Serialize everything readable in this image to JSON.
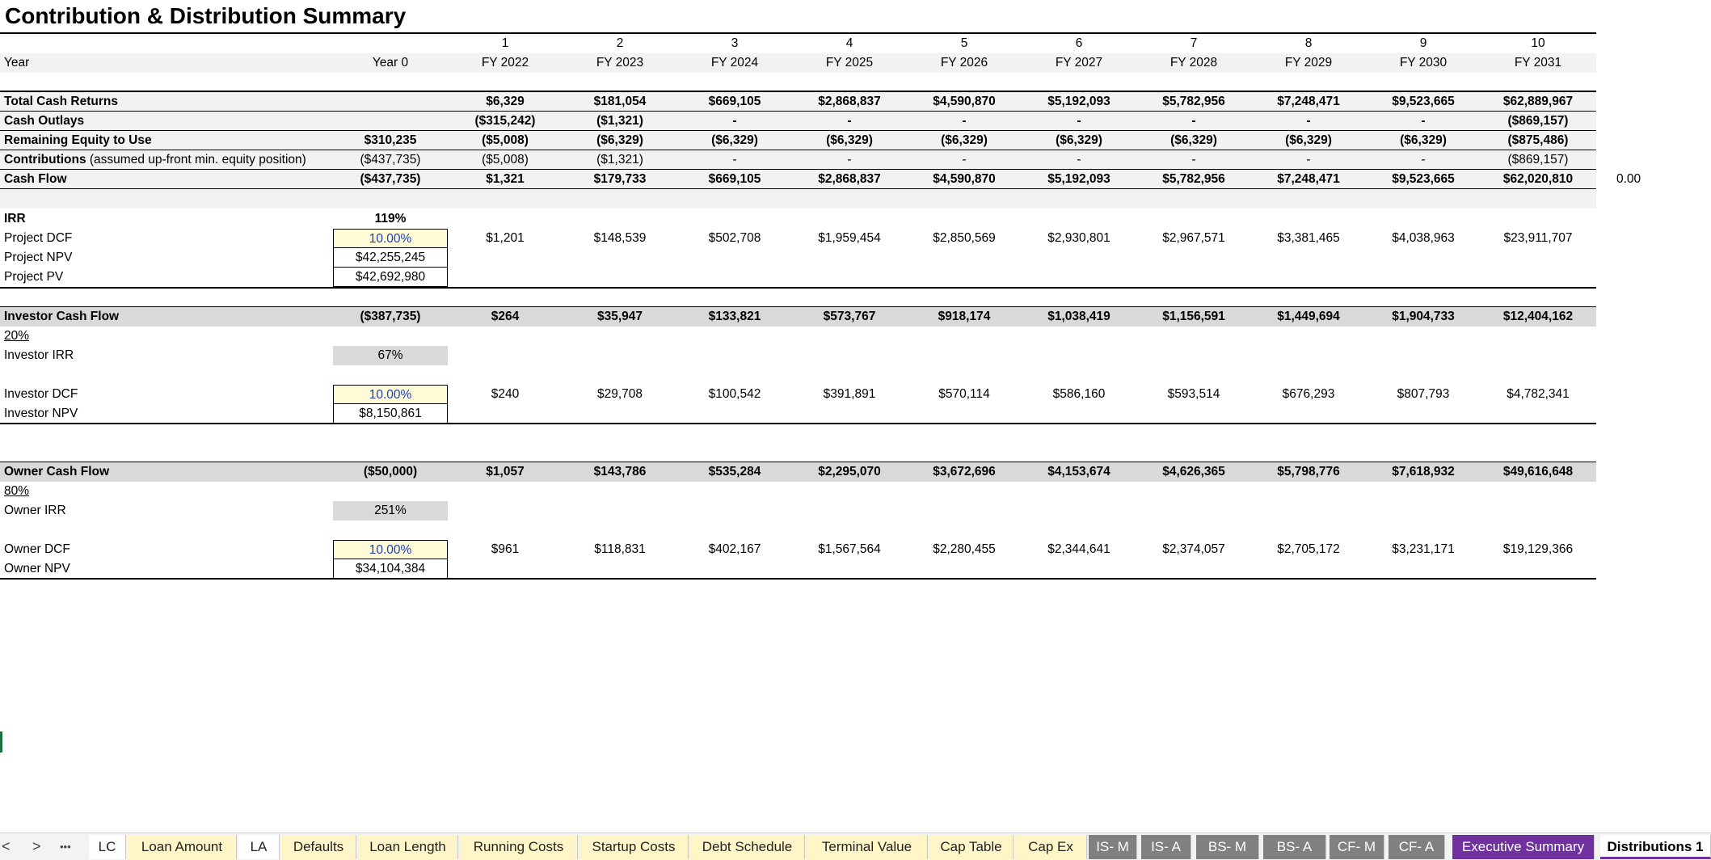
{
  "title": "Contribution & Distribution Summary",
  "period_numbers": [
    "1",
    "2",
    "3",
    "4",
    "5",
    "6",
    "7",
    "8",
    "9",
    "10"
  ],
  "header": {
    "label": "Year",
    "year0": "Year 0",
    "years": [
      "FY 2022",
      "FY 2023",
      "FY 2024",
      "FY 2025",
      "FY 2026",
      "FY 2027",
      "FY 2028",
      "FY 2029",
      "FY 2030",
      "FY 2031"
    ]
  },
  "summary_rows": [
    {
      "label": "Total Cash Returns",
      "y0": "",
      "values": [
        "$6,329",
        "$181,054",
        "$669,105",
        "$2,868,837",
        "$4,590,870",
        "$5,192,093",
        "$5,782,956",
        "$7,248,471",
        "$9,523,665",
        "$62,889,967"
      ]
    },
    {
      "label": "Cash Outlays",
      "y0": "",
      "values": [
        "($315,242)",
        "($1,321)",
        "-",
        "-",
        "-",
        "-",
        "-",
        "-",
        "-",
        "($869,157)"
      ]
    },
    {
      "label": "Remaining Equity to Use",
      "y0": "$310,235",
      "values": [
        "($5,008)",
        "($6,329)",
        "($6,329)",
        "($6,329)",
        "($6,329)",
        "($6,329)",
        "($6,329)",
        "($6,329)",
        "($6,329)",
        "($875,486)"
      ]
    },
    {
      "label": "Contributions",
      "label_suffix": " (assumed up-front min. equity position)",
      "y0": "($437,735)",
      "values": [
        "($5,008)",
        "($1,321)",
        "-",
        "-",
        "-",
        "-",
        "-",
        "-",
        "-",
        "($869,157)"
      ]
    },
    {
      "label": "Cash Flow",
      "y0": "($437,735)",
      "values": [
        "$1,321",
        "$179,733",
        "$669,105",
        "$2,868,837",
        "$4,590,870",
        "$5,192,093",
        "$5,782,956",
        "$7,248,471",
        "$9,523,665",
        "$62,020,810"
      ],
      "extra": "0.00"
    }
  ],
  "project": {
    "irr_label": "IRR",
    "irr": "119%",
    "dcf_label": "Project DCF",
    "dcf_rate": "10.00%",
    "dcf_values": [
      "$1,201",
      "$148,539",
      "$502,708",
      "$1,959,454",
      "$2,850,569",
      "$2,930,801",
      "$2,967,571",
      "$3,381,465",
      "$4,038,963",
      "$23,911,707"
    ],
    "npv_label": "Project NPV",
    "npv": "$42,255,245",
    "pv_label": "Project PV",
    "pv": "$42,692,980"
  },
  "investor": {
    "cf_label": "Investor Cash Flow",
    "y0": "($387,735)",
    "values": [
      "$264",
      "$35,947",
      "$133,821",
      "$573,767",
      "$918,174",
      "$1,038,419",
      "$1,156,591",
      "$1,449,694",
      "$1,904,733",
      "$12,404,162"
    ],
    "share": "20%",
    "irr_label": "Investor IRR",
    "irr": "67%",
    "dcf_label": "Investor DCF",
    "dcf_rate": "10.00%",
    "dcf_values": [
      "$240",
      "$29,708",
      "$100,542",
      "$391,891",
      "$570,114",
      "$586,160",
      "$593,514",
      "$676,293",
      "$807,793",
      "$4,782,341"
    ],
    "npv_label": "Investor NPV",
    "npv": "$8,150,861"
  },
  "owner": {
    "cf_label": "Owner Cash Flow",
    "y0": "($50,000)",
    "values": [
      "$1,057",
      "$143,786",
      "$535,284",
      "$2,295,070",
      "$3,672,696",
      "$4,153,674",
      "$4,626,365",
      "$5,798,776",
      "$7,618,932",
      "$49,616,648"
    ],
    "share": "80%",
    "irr_label": "Owner IRR",
    "irr": "251%",
    "dcf_label": "Owner DCF",
    "dcf_rate": "10.00%",
    "dcf_values": [
      "$961",
      "$118,831",
      "$402,167",
      "$1,567,564",
      "$2,280,455",
      "$2,344,641",
      "$2,374,057",
      "$2,705,172",
      "$3,231,171",
      "$19,129,366"
    ],
    "npv_label": "Owner NPV",
    "npv": "$34,104,384"
  },
  "tabs": {
    "nav": [
      "<",
      ">",
      "•••"
    ],
    "sheets": [
      "LC",
      "Loan Amount",
      "LA",
      "Defaults",
      "Loan Length",
      "Running Costs",
      "Startup Costs",
      "Debt Schedule",
      "Terminal Value",
      "Cap Table",
      "Cap Ex",
      "IS- M",
      "IS- A",
      "BS- M",
      "BS- A",
      "CF- M",
      "CF- A",
      "Executive Summary",
      "Distributions 1"
    ]
  }
}
